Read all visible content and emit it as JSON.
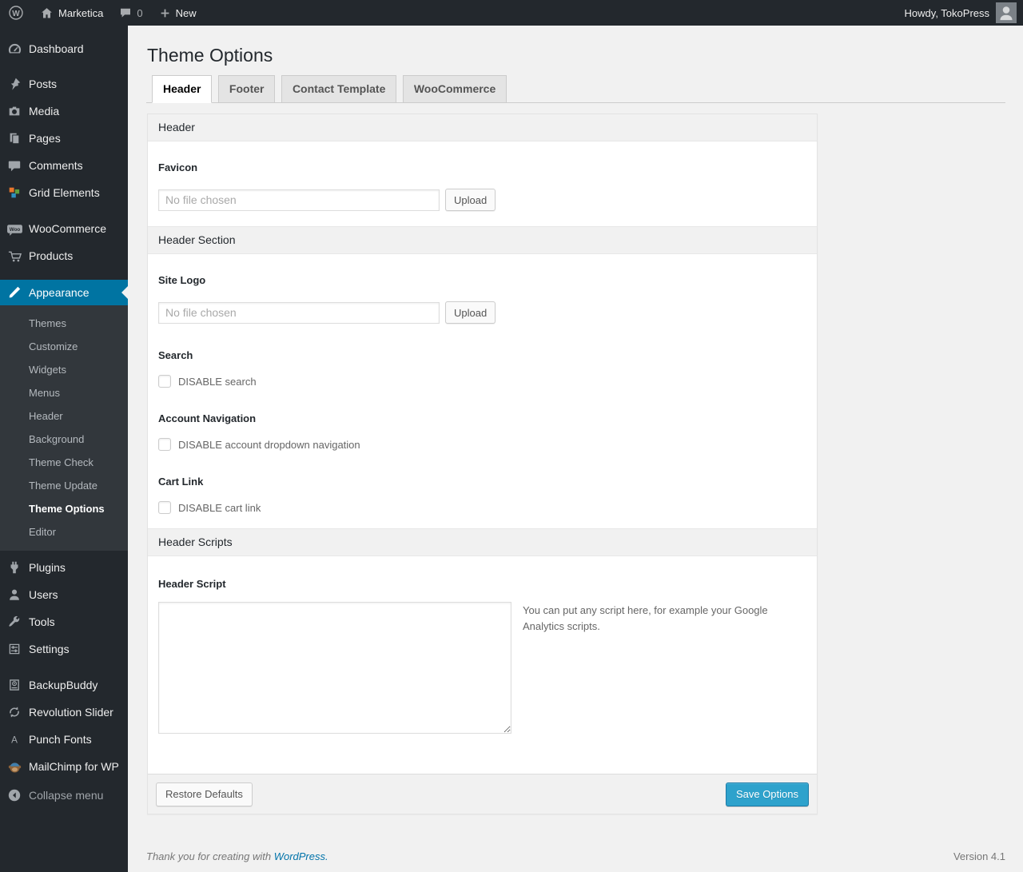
{
  "colors": {
    "menu_active_bg": "#0074a2",
    "primary_button_bg": "#2ea2cc",
    "link_blue": "#0073aa",
    "admin_bar_bg": "#23282d",
    "submenu_bg": "#32373c"
  },
  "admin_bar": {
    "logo_glyph": "W",
    "site_name": "Marketica",
    "comment_count": "0",
    "new_label": "New",
    "howdy_text": "Howdy, TokoPress"
  },
  "sidebar": {
    "top_items": [
      {
        "label": "Dashboard",
        "icon": "dashboard-icon"
      },
      {
        "label": "Posts",
        "icon": "pushpin-icon"
      },
      {
        "label": "Media",
        "icon": "camera-icon"
      },
      {
        "label": "Pages",
        "icon": "pages-icon"
      },
      {
        "label": "Comments",
        "icon": "comment-icon"
      },
      {
        "label": "Grid Elements",
        "icon": "grid-icon"
      },
      {
        "label": "WooCommerce",
        "icon": "woo-badge-icon",
        "badge": "Woo"
      },
      {
        "label": "Products",
        "icon": "cart-icon"
      }
    ],
    "appearance_label": "Appearance",
    "appearance_submenu": [
      {
        "label": "Themes"
      },
      {
        "label": "Customize"
      },
      {
        "label": "Widgets"
      },
      {
        "label": "Menus"
      },
      {
        "label": "Header"
      },
      {
        "label": "Background"
      },
      {
        "label": "Theme Check"
      },
      {
        "label": "Theme Update"
      },
      {
        "label": "Theme Options",
        "current": true
      },
      {
        "label": "Editor"
      }
    ],
    "bottom_items": [
      {
        "label": "Plugins",
        "icon": "plug-icon"
      },
      {
        "label": "Users",
        "icon": "user-icon"
      },
      {
        "label": "Tools",
        "icon": "wrench-icon"
      },
      {
        "label": "Settings",
        "icon": "sliders-icon"
      },
      {
        "label": "BackupBuddy",
        "icon": "backup-disk-icon"
      },
      {
        "label": "Revolution Slider",
        "icon": "refresh-arrows-icon"
      },
      {
        "label": "Punch Fonts",
        "icon": "letter-a-icon",
        "glyph": "A"
      },
      {
        "label": "MailChimp for WP",
        "icon": "monkey-icon"
      }
    ],
    "collapse_label": "Collapse menu"
  },
  "main": {
    "page_title": "Theme Options",
    "tabs": [
      {
        "label": "Header",
        "active": true
      },
      {
        "label": "Footer",
        "active": false
      },
      {
        "label": "Contact Template",
        "active": false
      },
      {
        "label": "WooCommerce",
        "active": false
      }
    ],
    "sections": {
      "header_title": "Header",
      "header_section_title": "Header Section",
      "header_scripts_title": "Header Scripts"
    },
    "fields": {
      "favicon": {
        "label": "Favicon",
        "file_text": "No file chosen",
        "button": "Upload"
      },
      "site_logo": {
        "label": "Site Logo",
        "file_text": "No file chosen",
        "button": "Upload"
      },
      "search": {
        "label": "Search",
        "checkbox": "DISABLE search",
        "checked": false
      },
      "account_nav": {
        "label": "Account Navigation",
        "checkbox": "DISABLE account dropdown navigation",
        "checked": false
      },
      "cart_link": {
        "label": "Cart Link",
        "checkbox": "DISABLE cart link",
        "checked": false
      },
      "header_script": {
        "label": "Header Script",
        "value": "",
        "help": "You can put any script here, for example your Google Analytics scripts."
      }
    },
    "actions": {
      "restore": "Restore Defaults",
      "save": "Save Options"
    }
  },
  "page_footer": {
    "thanks_text": "Thank you for creating with ",
    "link_text": "WordPress.",
    "version": "Version 4.1"
  }
}
